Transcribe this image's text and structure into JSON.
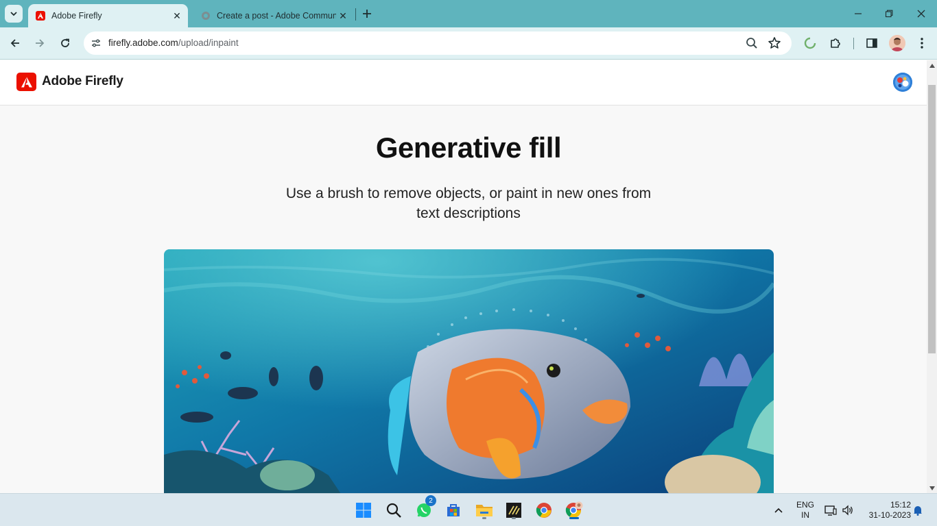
{
  "browser": {
    "tabs": [
      {
        "title": "Adobe Firefly",
        "active": true
      },
      {
        "title": "Create a post - Adobe Community",
        "active": false
      }
    ],
    "url_host": "firefly.adobe.com",
    "url_path": "/upload/inpaint"
  },
  "app": {
    "brand": "Adobe Firefly",
    "title": "Generative fill",
    "subtitle": "Use a brush to remove objects, or paint in new ones from text descriptions"
  },
  "colors": {
    "tabstrip": "#5fb4bd",
    "toolbar": "#dff1f3",
    "adobe_red": "#eb1000",
    "taskbar": "#dbe7ee"
  },
  "taskbar": {
    "apps": [
      "start-icon",
      "search-icon",
      "whatsapp-icon",
      "store-icon",
      "file-explorer-icon",
      "terminal-icon",
      "chrome-icon",
      "chrome-profile-icon"
    ],
    "whatsapp_badge": "2",
    "language": "ENG",
    "region": "IN",
    "time": "15:12",
    "date": "31-10-2023"
  }
}
